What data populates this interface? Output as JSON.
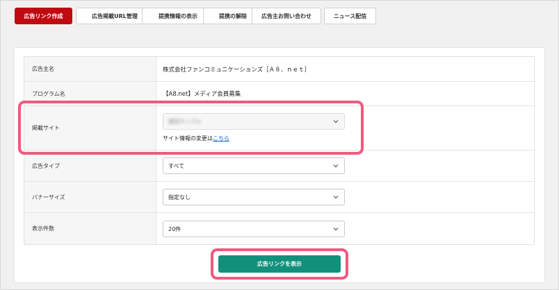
{
  "tabs": [
    {
      "label": "広告リンク作成",
      "active": true
    },
    {
      "label": "広告掲載URL管理",
      "active": false
    },
    {
      "label": "提携情報の表示",
      "active": false
    },
    {
      "label": "提携の解除",
      "active": false
    },
    {
      "label": "広告主お問い合わせ",
      "active": false
    },
    {
      "label": "ニュース配信",
      "active": false
    }
  ],
  "form": {
    "advertiser": {
      "label": "広告主名",
      "value": "株式会社ファンコミュニケーションズ［Ａ８．ｎｅｔ］"
    },
    "program": {
      "label": "プログラム名",
      "value": "【A8.net】メディア会員募集"
    },
    "site": {
      "label": "掲載サイト",
      "selected": "運営サンプル",
      "note_text": "サイト情報の変更は",
      "note_link": "こちら"
    },
    "ad_type": {
      "label": "広告タイプ",
      "selected": "すべて"
    },
    "banner_size": {
      "label": "バナーサイズ",
      "selected": "指定なし"
    },
    "display_count": {
      "label": "表示件数",
      "selected": "20件"
    }
  },
  "submit_label": "広告リンクを表示",
  "colors": {
    "active_tab": "#c00a12",
    "submit": "#13907c",
    "highlight": "#ee5a7e",
    "link": "#0b63c4"
  },
  "icons": {
    "select_arrow": "chevron-down-icon"
  }
}
